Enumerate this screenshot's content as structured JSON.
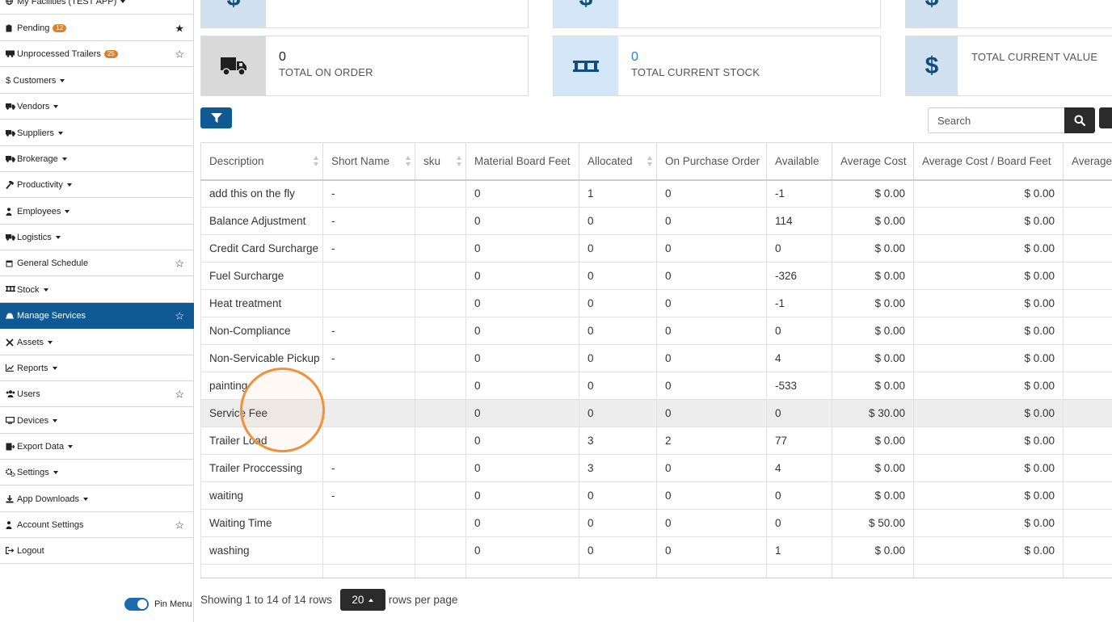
{
  "sidebar": {
    "items": [
      {
        "label": "My Facilities (TEST APP)",
        "icon": "globe-icon",
        "caret": true,
        "star": false
      },
      {
        "label": "Pending",
        "icon": "clipboard-icon",
        "badge": "12",
        "star": "filled"
      },
      {
        "label": "Unprocessed Trailers",
        "icon": "trailer-icon",
        "badge": "25",
        "star": "outline"
      },
      {
        "label": "$ Customers",
        "icon": "",
        "caret": true
      },
      {
        "label": "Vendors",
        "icon": "truck-icon",
        "caret": true
      },
      {
        "label": "Suppliers",
        "icon": "truck-icon",
        "caret": true
      },
      {
        "label": "Brokerage",
        "icon": "truck-icon",
        "caret": true
      },
      {
        "label": "Productivity",
        "icon": "hammer-icon",
        "caret": true
      },
      {
        "label": "Employees",
        "icon": "person-icon",
        "caret": true
      },
      {
        "label": "Logistics",
        "icon": "truck-icon",
        "caret": true
      },
      {
        "label": "General Schedule",
        "icon": "calendar-icon",
        "star": "outline"
      },
      {
        "label": "Stock",
        "icon": "pallet-icon",
        "caret": true
      },
      {
        "label": "Manage Services",
        "icon": "bell-icon",
        "star": "outline",
        "active": true
      },
      {
        "label": "Assets",
        "icon": "tools-icon",
        "caret": true
      },
      {
        "label": "Reports",
        "icon": "chart-icon",
        "caret": true
      },
      {
        "label": "Users",
        "icon": "users-icon",
        "star": "outline"
      },
      {
        "label": "Devices",
        "icon": "monitor-icon",
        "caret": true
      },
      {
        "label": "Export Data",
        "icon": "export-icon",
        "caret": true
      },
      {
        "label": "Settings",
        "icon": "gears-icon",
        "caret": true
      },
      {
        "label": "App Downloads",
        "icon": "download-icon",
        "caret": true
      },
      {
        "label": "Account Settings",
        "icon": "person-icon",
        "star": "outline"
      },
      {
        "label": "Logout",
        "icon": "logout-icon"
      }
    ],
    "pin_menu_label": "Pin Menu"
  },
  "cards": [
    {
      "value": "0",
      "label": "TOTAL ON ORDER",
      "icon": "truck-icon",
      "icon_bg": "#d9d9d9"
    },
    {
      "value": "0",
      "label": "TOTAL CURRENT STOCK",
      "icon": "pallet-icon",
      "icon_bg": "#d3e7f8"
    },
    {
      "label": "TOTAL CURRENT VALUE",
      "icon": "dollar-icon",
      "icon_bg": "#d0e0ef"
    }
  ],
  "toolbar": {
    "search_placeholder": "Search"
  },
  "table": {
    "columns": [
      "Description",
      "Short Name",
      "sku",
      "Material Board Feet",
      "Allocated",
      "On Purchase Order",
      "Available",
      "Average Cost",
      "Average Cost / Board Feet",
      "Average"
    ],
    "rows": [
      [
        "add this on the fly",
        "-",
        "",
        "0",
        "1",
        "0",
        "-1",
        "$ 0.00",
        "$ 0.00",
        ""
      ],
      [
        "Balance Adjustment",
        "-",
        "",
        "0",
        "0",
        "0",
        "114",
        "$ 0.00",
        "$ 0.00",
        ""
      ],
      [
        "Credit Card Surcharge",
        "-",
        "",
        "0",
        "0",
        "0",
        "0",
        "$ 0.00",
        "$ 0.00",
        ""
      ],
      [
        "Fuel Surcharge",
        "",
        "",
        "0",
        "0",
        "0",
        "-326",
        "$ 0.00",
        "$ 0.00",
        ""
      ],
      [
        "Heat treatment",
        "",
        "",
        "0",
        "0",
        "0",
        "-1",
        "$ 0.00",
        "$ 0.00",
        ""
      ],
      [
        "Non-Compliance",
        "-",
        "",
        "0",
        "0",
        "0",
        "0",
        "$ 0.00",
        "$ 0.00",
        ""
      ],
      [
        "Non-Servicable Pickup",
        "-",
        "",
        "0",
        "0",
        "0",
        "4",
        "$ 0.00",
        "$ 0.00",
        ""
      ],
      [
        "painting",
        "",
        "",
        "0",
        "0",
        "0",
        "-533",
        "$ 0.00",
        "$ 0.00",
        ""
      ],
      [
        "Service Fee",
        "",
        "",
        "0",
        "0",
        "0",
        "0",
        "$ 30.00",
        "$ 0.00",
        ""
      ],
      [
        "Trailer Load",
        "",
        "",
        "0",
        "3",
        "2",
        "77",
        "$ 0.00",
        "$ 0.00",
        ""
      ],
      [
        "Trailer Proccessing",
        "-",
        "",
        "0",
        "3",
        "0",
        "4",
        "$ 0.00",
        "$ 0.00",
        ""
      ],
      [
        "waiting",
        "-",
        "",
        "0",
        "0",
        "0",
        "0",
        "$ 0.00",
        "$ 0.00",
        ""
      ],
      [
        "Waiting Time",
        "",
        "",
        "0",
        "0",
        "0",
        "0",
        "$ 50.00",
        "$ 0.00",
        ""
      ],
      [
        "washing",
        "",
        "",
        "0",
        "0",
        "0",
        "1",
        "$ 0.00",
        "$ 0.00",
        ""
      ]
    ],
    "highlighted_row": 8
  },
  "pagination": {
    "showing_text": "Showing 1 to 14 of 14 rows",
    "page_size": "20",
    "per_page_text": "rows per page"
  },
  "colors": {
    "primary": "#0f5a94",
    "badge": "#d9822b",
    "click_marker": "#f0913d"
  }
}
